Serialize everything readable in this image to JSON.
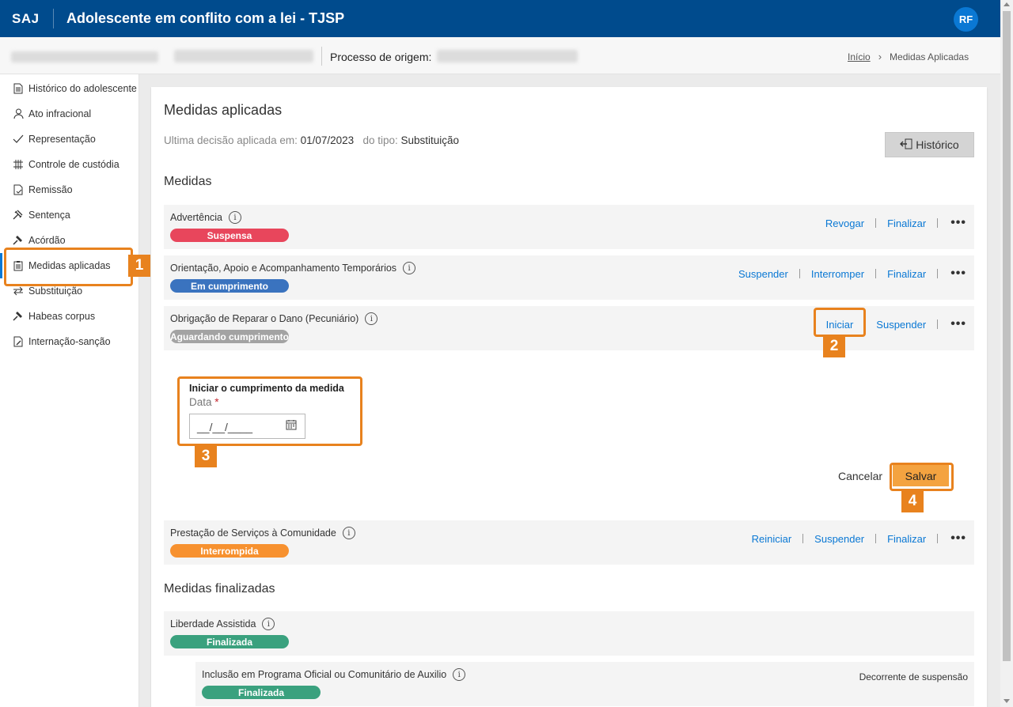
{
  "header": {
    "logo": "SAJ",
    "title": "Adolescente em conflito com a lei - TJSP",
    "user_initials": "RF"
  },
  "subheader": {
    "origin_label": "Processo de origem:"
  },
  "breadcrumb": {
    "home": "Início",
    "current": "Medidas Aplicadas"
  },
  "sidebar": {
    "items": [
      {
        "label": "Histórico do adolescente",
        "icon": "document-icon"
      },
      {
        "label": "Ato infracional",
        "icon": "person-icon"
      },
      {
        "label": "Representação",
        "icon": "check-icon"
      },
      {
        "label": "Controle de custódia",
        "icon": "grid-icon"
      },
      {
        "label": "Remissão",
        "icon": "document-check-icon"
      },
      {
        "label": "Sentença",
        "icon": "gavel-icon"
      },
      {
        "label": "Acórdão",
        "icon": "gavel-icon"
      },
      {
        "label": "Medidas aplicadas",
        "icon": "clipboard-icon"
      },
      {
        "label": "Substituição",
        "icon": "swap-icon"
      },
      {
        "label": "Habeas corpus",
        "icon": "gavel-icon"
      },
      {
        "label": "Internação-sanção",
        "icon": "document-edit-icon"
      }
    ]
  },
  "main": {
    "title": "Medidas aplicadas",
    "last_decision": {
      "label": "Ultima decisão aplicada em:",
      "date": "01/07/2023",
      "type_label": "do tipo:",
      "type": "Substituição"
    },
    "history_button": "Histórico",
    "section_medidas": "Medidas",
    "section_finalizadas": "Medidas finalizadas",
    "medidas": [
      {
        "name": "Advertência",
        "status": "Suspensa",
        "status_color": "#e8465c",
        "actions": [
          "Revogar",
          "Finalizar"
        ]
      },
      {
        "name": "Orientação, Apoio e Acompanhamento Temporários",
        "status": "Em cumprimento",
        "status_color": "#3a73bf",
        "actions": [
          "Suspender",
          "Interromper",
          "Finalizar"
        ]
      },
      {
        "name": "Obrigação de Reparar o Dano (Pecuniário)",
        "status": "Aguardando cumprimento",
        "status_color": "#a3a3a3",
        "actions": [
          "Iniciar",
          "Suspender"
        ]
      },
      {
        "name": "Prestação de Serviços à Comunidade",
        "status": "Interrompida",
        "status_color": "#f7912f",
        "actions": [
          "Reiniciar",
          "Suspender",
          "Finalizar"
        ]
      }
    ],
    "form": {
      "title": "Iniciar o cumprimento da medida",
      "date_label": "Data",
      "required_mark": "*",
      "date_placeholder": "__/__/____",
      "cancel": "Cancelar",
      "save": "Salvar"
    },
    "finalizadas": [
      {
        "name": "Liberdade Assistida",
        "status": "Finalizada",
        "status_color": "#3aa17e"
      },
      {
        "name": "Inclusão em Programa Oficial ou Comunitário de Auxilio",
        "status": "Finalizada",
        "status_color": "#3aa17e",
        "note": "Decorrente de suspensão"
      }
    ],
    "more_label": "•••",
    "info_glyph": "i"
  },
  "callouts": [
    "1",
    "2",
    "3",
    "4"
  ]
}
